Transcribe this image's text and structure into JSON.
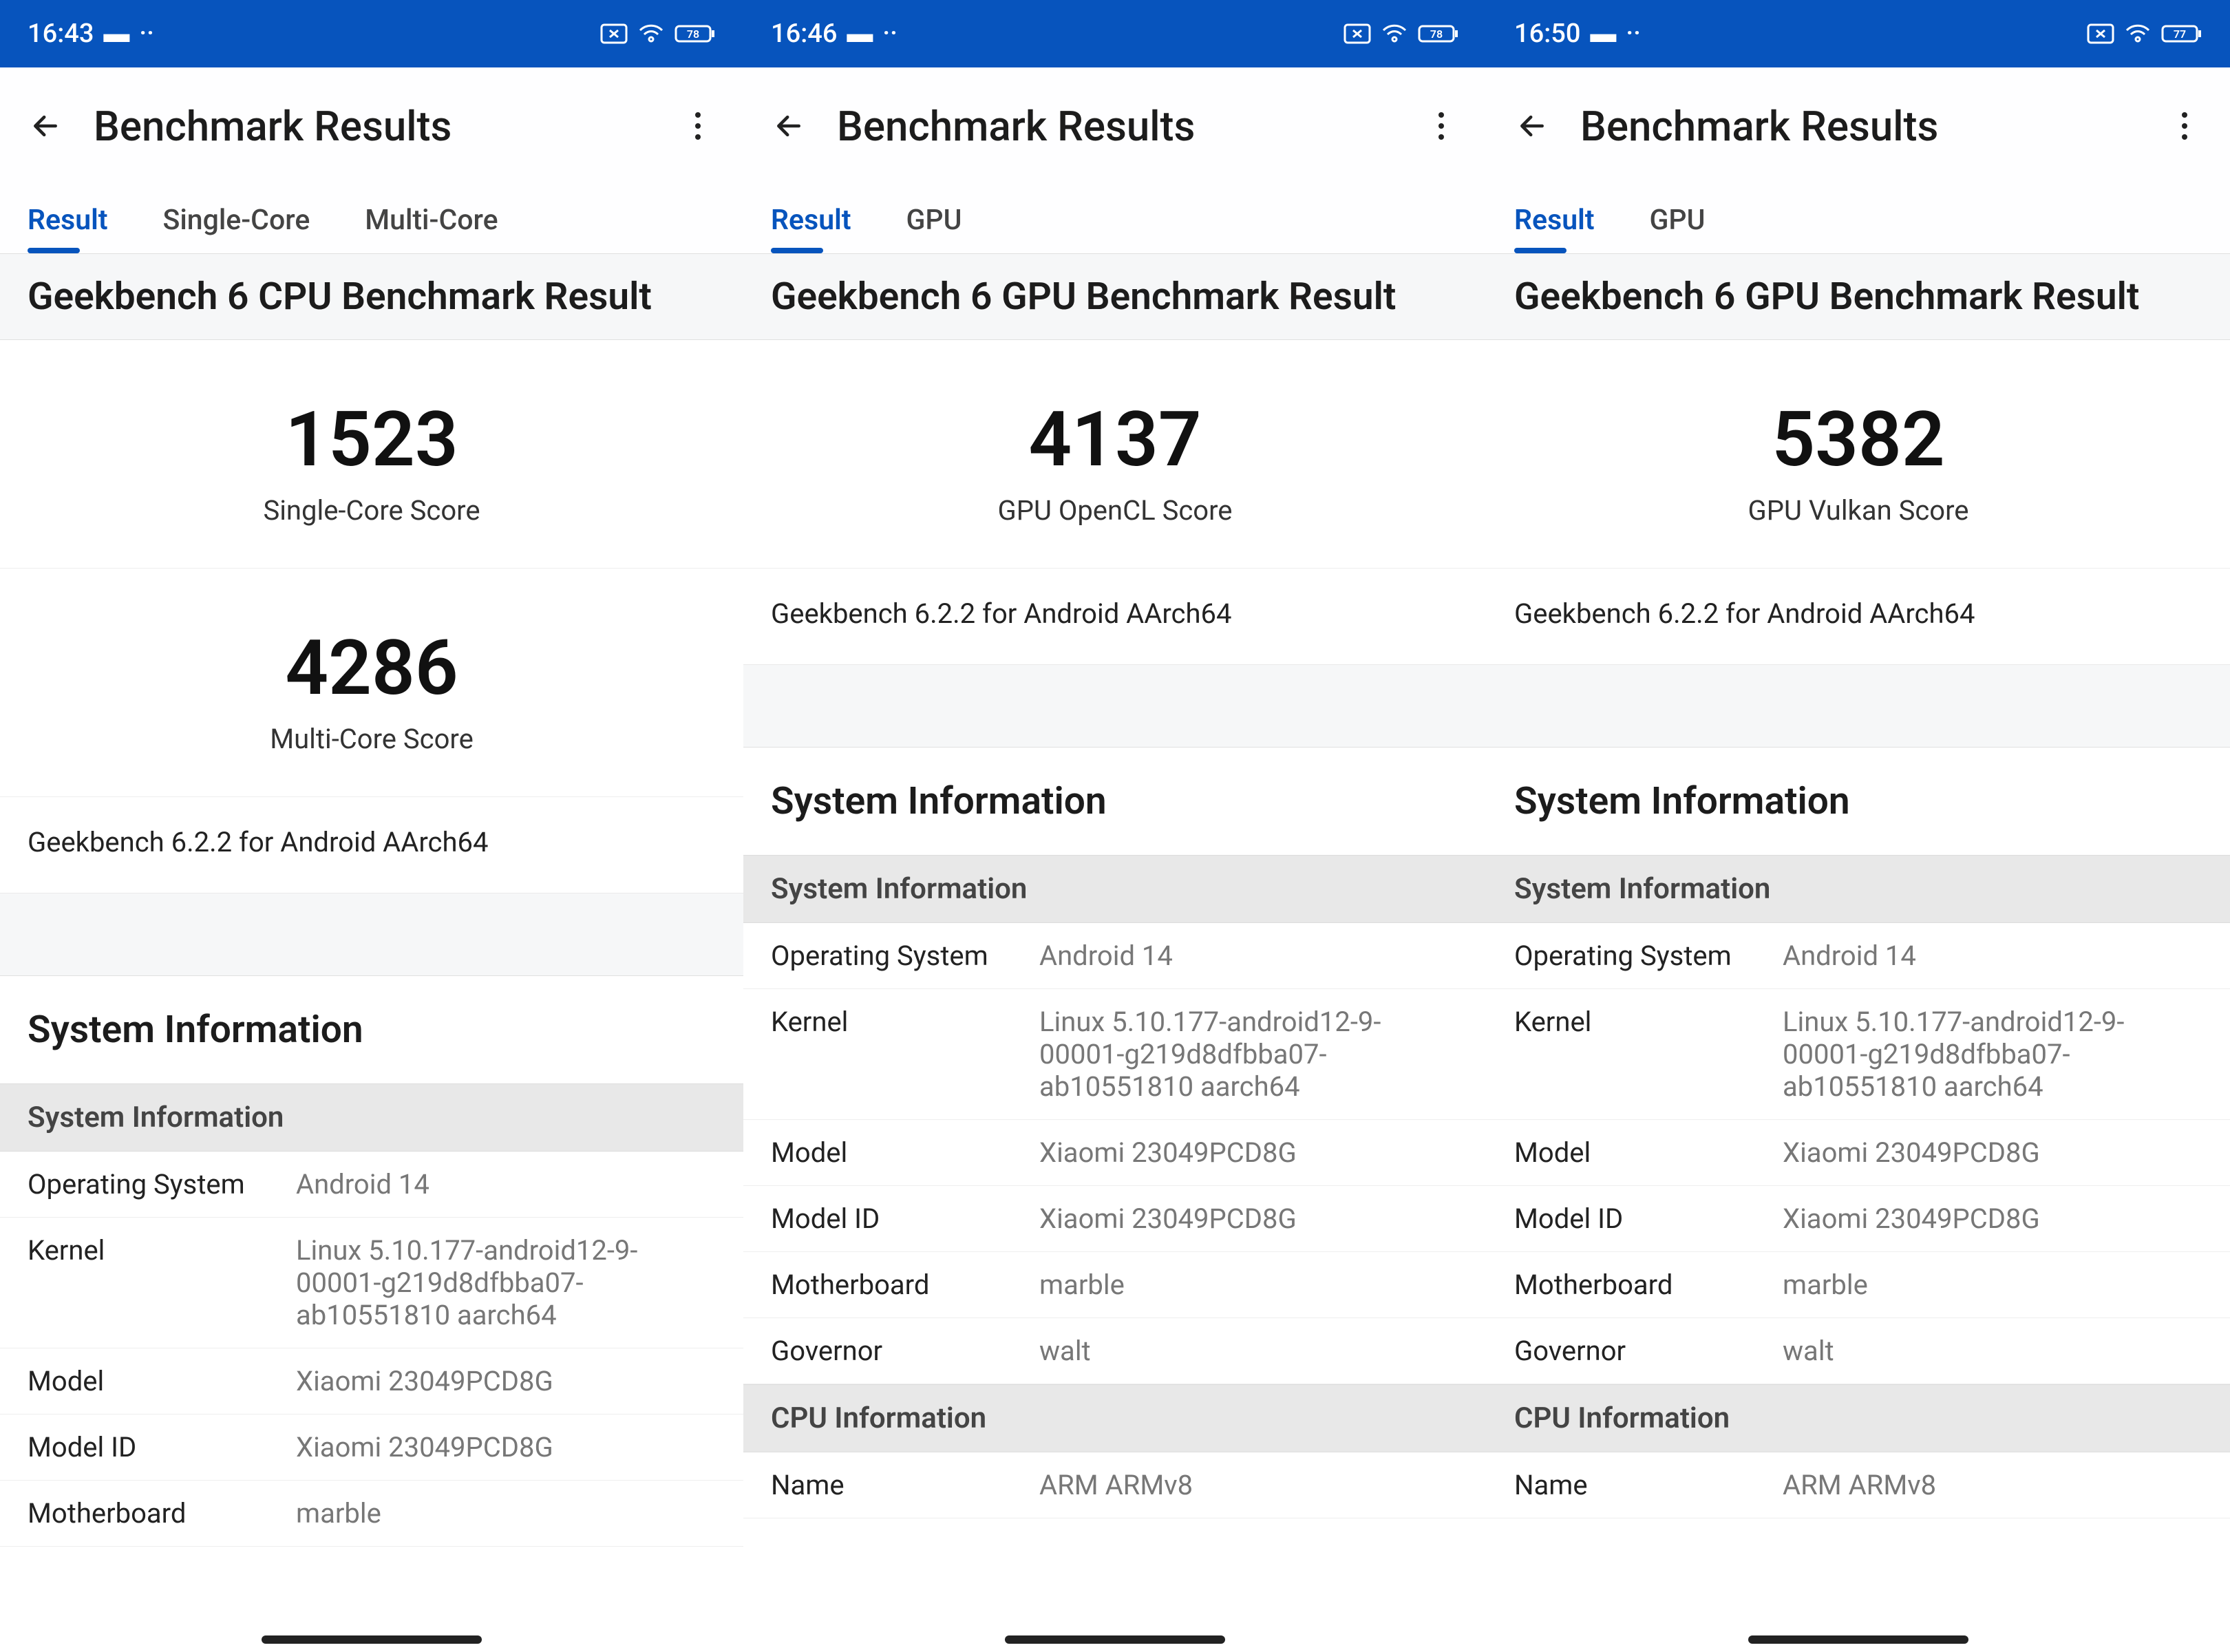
{
  "screens": [
    {
      "status": {
        "time": "16:43",
        "battery": "78"
      },
      "appbar_title": "Benchmark Results",
      "tabs": [
        {
          "label": "Result",
          "active": true
        },
        {
          "label": "Single-Core",
          "active": false
        },
        {
          "label": "Multi-Core",
          "active": false
        }
      ],
      "result_title": "Geekbench 6 CPU Benchmark Result",
      "scores": [
        {
          "value": "1523",
          "label": "Single-Core Score"
        },
        {
          "value": "4286",
          "label": "Multi-Core Score"
        }
      ],
      "version": "Geekbench 6.2.2 for Android AArch64",
      "sysinfo_heading": "System Information",
      "sysinfo_sub": "System Information",
      "sysinfo_rows": [
        {
          "k": "Operating System",
          "v": "Android 14"
        },
        {
          "k": "Kernel",
          "v": "Linux 5.10.177-android12-9-00001-g219d8dfbba07-ab10551810 aarch64"
        },
        {
          "k": "Model",
          "v": "Xiaomi 23049PCD8G"
        },
        {
          "k": "Model ID",
          "v": "Xiaomi 23049PCD8G"
        },
        {
          "k": "Motherboard",
          "v": "marble"
        }
      ],
      "cpu_sub": null,
      "cpu_rows": []
    },
    {
      "status": {
        "time": "16:46",
        "battery": "78"
      },
      "appbar_title": "Benchmark Results",
      "tabs": [
        {
          "label": "Result",
          "active": true
        },
        {
          "label": "GPU",
          "active": false
        }
      ],
      "result_title": "Geekbench 6 GPU Benchmark Result",
      "scores": [
        {
          "value": "4137",
          "label": "GPU OpenCL Score"
        }
      ],
      "version": "Geekbench 6.2.2 for Android AArch64",
      "sysinfo_heading": "System Information",
      "sysinfo_sub": "System Information",
      "sysinfo_rows": [
        {
          "k": "Operating System",
          "v": "Android 14"
        },
        {
          "k": "Kernel",
          "v": "Linux 5.10.177-android12-9-00001-g219d8dfbba07-ab10551810 aarch64"
        },
        {
          "k": "Model",
          "v": "Xiaomi 23049PCD8G"
        },
        {
          "k": "Model ID",
          "v": "Xiaomi 23049PCD8G"
        },
        {
          "k": "Motherboard",
          "v": "marble"
        },
        {
          "k": "Governor",
          "v": "walt"
        }
      ],
      "cpu_sub": "CPU Information",
      "cpu_rows": [
        {
          "k": "Name",
          "v": "ARM ARMv8"
        }
      ]
    },
    {
      "status": {
        "time": "16:50",
        "battery": "77"
      },
      "appbar_title": "Benchmark Results",
      "tabs": [
        {
          "label": "Result",
          "active": true
        },
        {
          "label": "GPU",
          "active": false
        }
      ],
      "result_title": "Geekbench 6 GPU Benchmark Result",
      "scores": [
        {
          "value": "5382",
          "label": "GPU Vulkan Score"
        }
      ],
      "version": "Geekbench 6.2.2 for Android AArch64",
      "sysinfo_heading": "System Information",
      "sysinfo_sub": "System Information",
      "sysinfo_rows": [
        {
          "k": "Operating System",
          "v": "Android 14"
        },
        {
          "k": "Kernel",
          "v": "Linux 5.10.177-android12-9-00001-g219d8dfbba07-ab10551810 aarch64"
        },
        {
          "k": "Model",
          "v": "Xiaomi 23049PCD8G"
        },
        {
          "k": "Model ID",
          "v": "Xiaomi 23049PCD8G"
        },
        {
          "k": "Motherboard",
          "v": "marble"
        },
        {
          "k": "Governor",
          "v": "walt"
        }
      ],
      "cpu_sub": "CPU Information",
      "cpu_rows": [
        {
          "k": "Name",
          "v": "ARM ARMv8"
        }
      ]
    }
  ]
}
